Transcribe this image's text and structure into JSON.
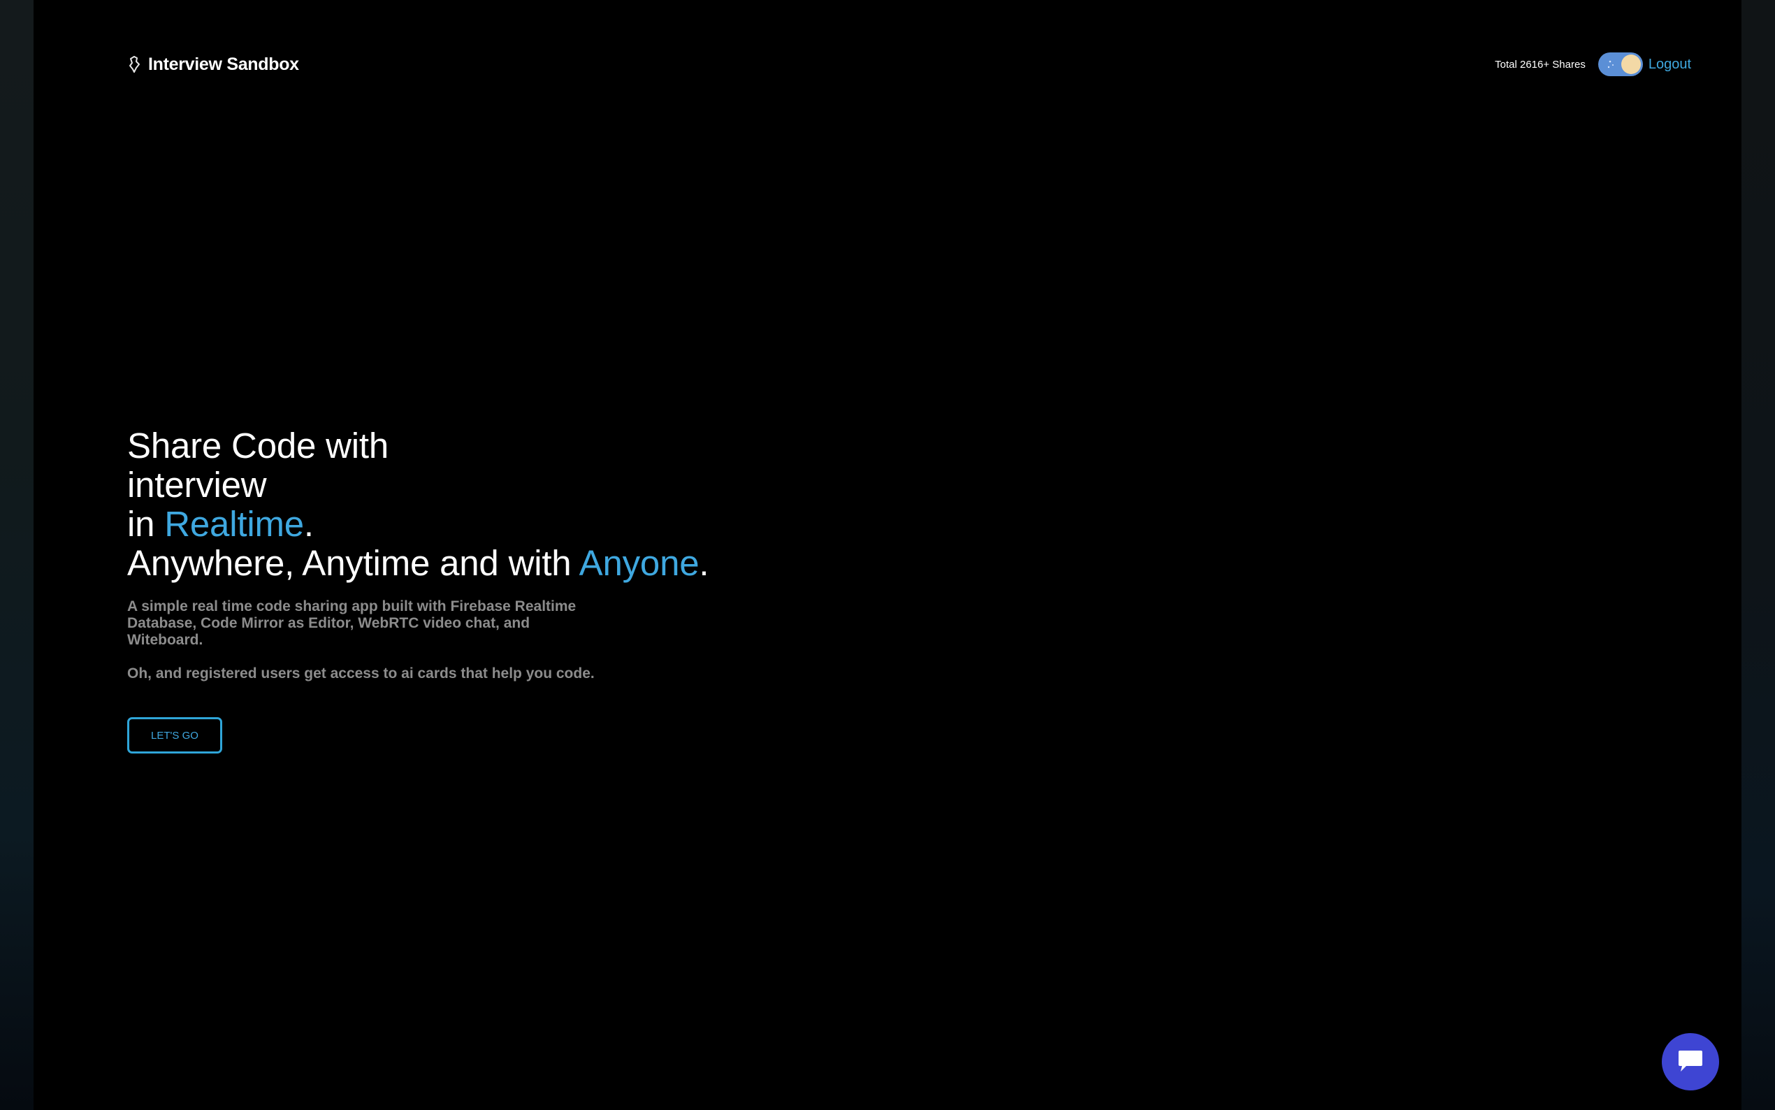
{
  "header": {
    "brand_name": "Interview Sandbox",
    "brand_icon": "code-bracket-icon",
    "shares_text": "Total 2616+ Shares",
    "logout_label": "Logout"
  },
  "hero": {
    "line1": "Share Code with",
    "line2": "interview",
    "line3_prefix": "in ",
    "line3_accent": "Realtime",
    "line3_suffix": ".",
    "line4_prefix": "Anywhere, Anytime and with ",
    "line4_accent": "Anyone",
    "line4_suffix": ".",
    "description": "A simple real time code sharing app built with Firebase Realtime Database, Code Mirror as Editor, WebRTC video chat, and Witeboard.",
    "description2": "Oh, and registered users get access to ai cards that help you code.",
    "cta_label": "LET'S GO"
  },
  "chat": {
    "icon": "chat-bubble-icon"
  },
  "colors": {
    "accent": "#3fa8e0",
    "chat_button": "#3e45d3",
    "toggle_track": "#5b8fd6",
    "toggle_knob": "#f3d9a6",
    "muted_text": "#8c8c8c"
  }
}
